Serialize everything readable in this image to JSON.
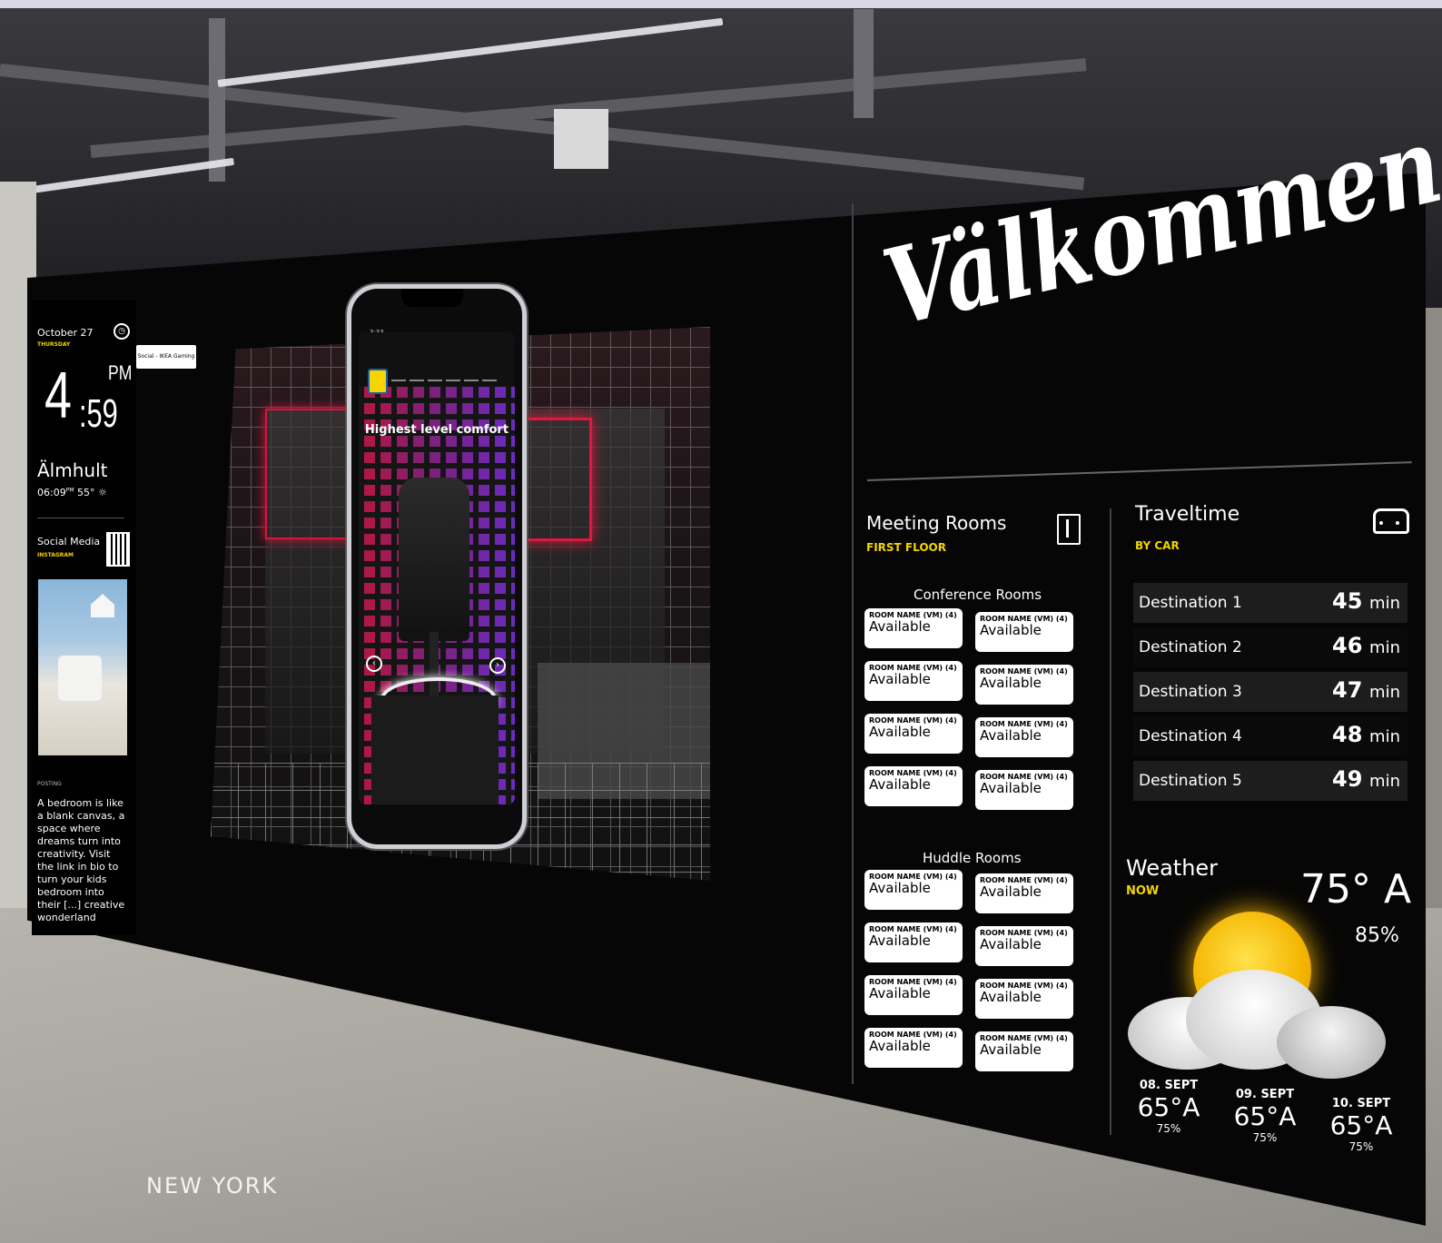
{
  "left_panel": {
    "date": "October 27",
    "weekday": "THURSDAY",
    "time_hour": "4",
    "time_minutes": ":59",
    "ampm": "PM",
    "city": "Älmhult",
    "local_time": "06:09",
    "local_time_suffix": "PM",
    "temperature": "55°",
    "social_title": "Social Media",
    "social_handle": "INSTAGRAM",
    "post_label": "POSTING",
    "post_text": "A bedroom is like a blank canvas, a space where dreams turn into creativity. Visit the link in bio to turn your kids bedroom into their [...] creative wonderland"
  },
  "tag_label": "Social - IKEA Gaming",
  "phone": {
    "status_time": "3:33",
    "headline": "Highest level comfort",
    "prev_icon": "chevron-left-icon",
    "next_icon": "chevron-right-icon"
  },
  "welcome": "Välkommen",
  "meeting": {
    "title": "Meeting Rooms",
    "subtitle": "FIRST FLOOR",
    "icon": "door-icon",
    "conference_heading": "Conference Rooms",
    "huddle_heading": "Huddle Rooms",
    "conference_rooms": [
      {
        "name": "ROOM NAME (VM) (4)",
        "status": "Available"
      },
      {
        "name": "ROOM NAME (VM) (4)",
        "status": "Available"
      },
      {
        "name": "ROOM NAME (VM) (4)",
        "status": "Available"
      },
      {
        "name": "ROOM NAME (VM) (4)",
        "status": "Available"
      },
      {
        "name": "ROOM NAME (VM) (4)",
        "status": "Available"
      },
      {
        "name": "ROOM NAME (VM) (4)",
        "status": "Available"
      },
      {
        "name": "ROOM NAME (VM) (4)",
        "status": "Available"
      },
      {
        "name": "ROOM NAME (VM) (4)",
        "status": "Available"
      }
    ],
    "huddle_rooms": [
      {
        "name": "ROOM NAME (VM) (4)",
        "status": "Available"
      },
      {
        "name": "ROOM NAME (VM) (4)",
        "status": "Available"
      },
      {
        "name": "ROOM NAME (VM) (4)",
        "status": "Available"
      },
      {
        "name": "ROOM NAME (VM) (4)",
        "status": "Available"
      },
      {
        "name": "ROOM NAME (VM) (4)",
        "status": "Available"
      },
      {
        "name": "ROOM NAME (VM) (4)",
        "status": "Available"
      },
      {
        "name": "ROOM NAME (VM) (4)",
        "status": "Available"
      },
      {
        "name": "ROOM NAME (VM) (4)",
        "status": "Available"
      }
    ]
  },
  "travel": {
    "title": "Traveltime",
    "subtitle": "BY CAR",
    "icon": "car-icon",
    "destinations": [
      {
        "name": "Destination 1",
        "value": "45",
        "unit": "min"
      },
      {
        "name": "Destination 2",
        "value": "46",
        "unit": "min"
      },
      {
        "name": "Destination 3",
        "value": "47",
        "unit": "min"
      },
      {
        "name": "Destination 4",
        "value": "48",
        "unit": "min"
      },
      {
        "name": "Destination 5",
        "value": "49",
        "unit": "min"
      }
    ]
  },
  "weather": {
    "title": "Weather",
    "subtitle": "NOW",
    "temp": "75° A",
    "humidity": "85%",
    "icon": "partly-cloudy-icon",
    "forecast": [
      {
        "date": "08. SEPT",
        "temp": "65°A",
        "humidity": "75%"
      },
      {
        "date": "09. SEPT",
        "temp": "65°A",
        "humidity": "75%"
      },
      {
        "date": "10. SEPT",
        "temp": "65°A",
        "humidity": "75%"
      }
    ]
  },
  "caption": "NEW YORK",
  "colors": {
    "accent_yellow": "#f2d400",
    "screen_bg": "#060606",
    "tile_bg": "#ffffff"
  }
}
